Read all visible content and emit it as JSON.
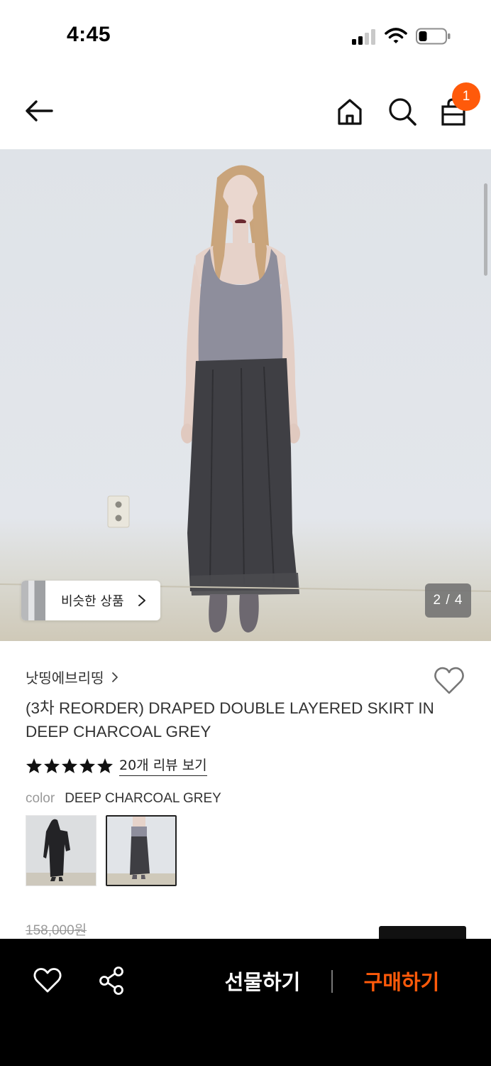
{
  "status_bar": {
    "time": "4:45",
    "signal_icon": "cellular-signal-icon",
    "wifi_icon": "wifi-icon",
    "battery_icon": "battery-icon"
  },
  "header": {
    "back_icon": "arrow-left-icon",
    "home_icon": "home-icon",
    "search_icon": "search-icon",
    "cart_icon": "shopping-bag-icon",
    "cart_count": "1",
    "badge_color": "#ff5a0a"
  },
  "gallery": {
    "similar_products_label": "비슷한 상품",
    "page_indicator": "2 / 4"
  },
  "product": {
    "brand": "낫띵에브리띵",
    "title": "(3차 REORDER) DRAPED DOUBLE LAYERED SKIRT IN DEEP CHARCOAL GREY",
    "rating": 5,
    "rating_max": 5,
    "review_link": "20개 리뷰 보기",
    "color_label": "color",
    "color_value": "DEEP CHARCOAL GREY",
    "original_price": "158,000원"
  },
  "bottom_bar": {
    "wishlist_icon": "heart-icon",
    "share_icon": "share-icon",
    "gift_label": "선물하기",
    "buy_label": "구매하기",
    "buy_color": "#ff5a0a"
  }
}
